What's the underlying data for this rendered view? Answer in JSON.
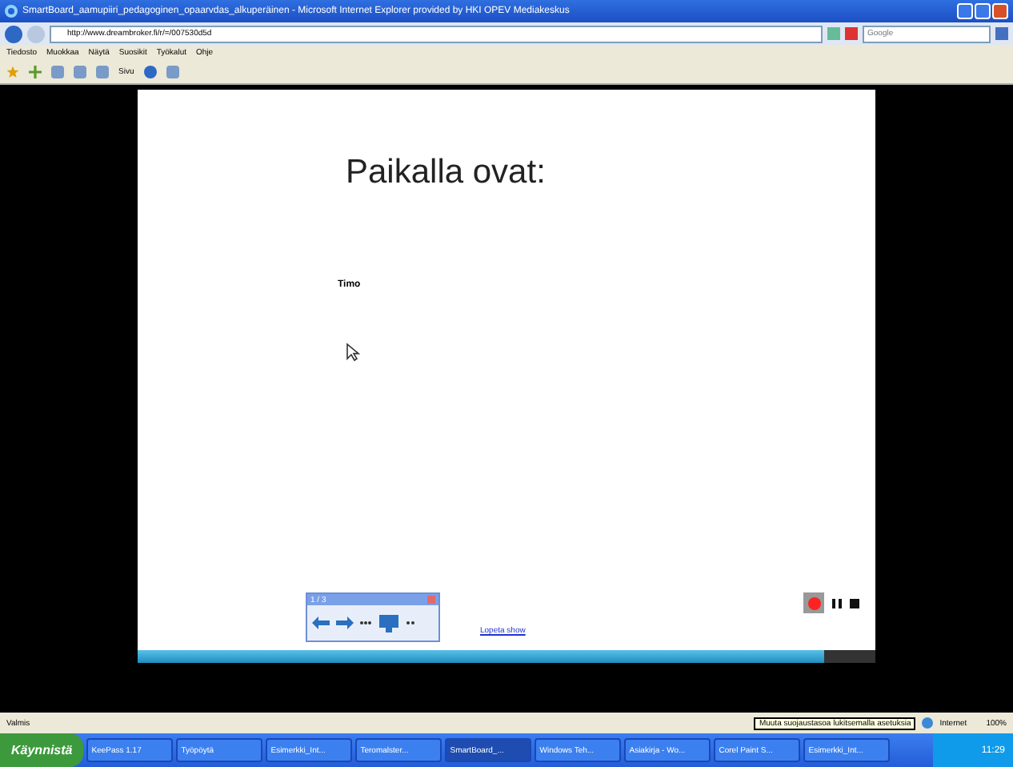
{
  "window": {
    "title": "SmartBoard_aamupiiri_pedagoginen_opaarvdas_alkuperäinen - Microsoft Internet Explorer provided by HKI OPEV Mediakeskus"
  },
  "address_bar": {
    "url": "http://www.dreambroker.fi/r/=/007530d5d"
  },
  "search": {
    "placeholder": "Google"
  },
  "menu": [
    "Tiedosto",
    "Muokkaa",
    "Näytä",
    "Suosikit",
    "Työkalut",
    "Ohje"
  ],
  "toolbar": {
    "page_label": "Sivu"
  },
  "slide": {
    "title": "Paikalla ovat:",
    "name": "Timo",
    "link": "Lopeta show"
  },
  "smartboard_toolbar": {
    "page": "1 / 3"
  },
  "recorder": {
    "recording": true
  },
  "video": {
    "level": 0.93
  },
  "status_bar": {
    "text": "Valmis",
    "zone": "Internet",
    "zoom": "100%",
    "tooltip": "Muuta suojaustasoa lukitsemalla asetuksia"
  },
  "taskbar": {
    "start": "Käynnistä",
    "clock": "11:29",
    "items": [
      {
        "label": "KeePass 1.17",
        "selected": false
      },
      {
        "label": "Työpöytä",
        "selected": false
      },
      {
        "label": "Esimerkki_Int...",
        "selected": false
      },
      {
        "label": "Teromalster...",
        "selected": false
      },
      {
        "label": "SmartBoard_...",
        "selected": true
      },
      {
        "label": "Windows Teh...",
        "selected": false
      },
      {
        "label": "Asiakirja - Wo...",
        "selected": false
      },
      {
        "label": "Corel Paint S...",
        "selected": false
      },
      {
        "label": "Esimerkki_Int...",
        "selected": false
      }
    ]
  }
}
